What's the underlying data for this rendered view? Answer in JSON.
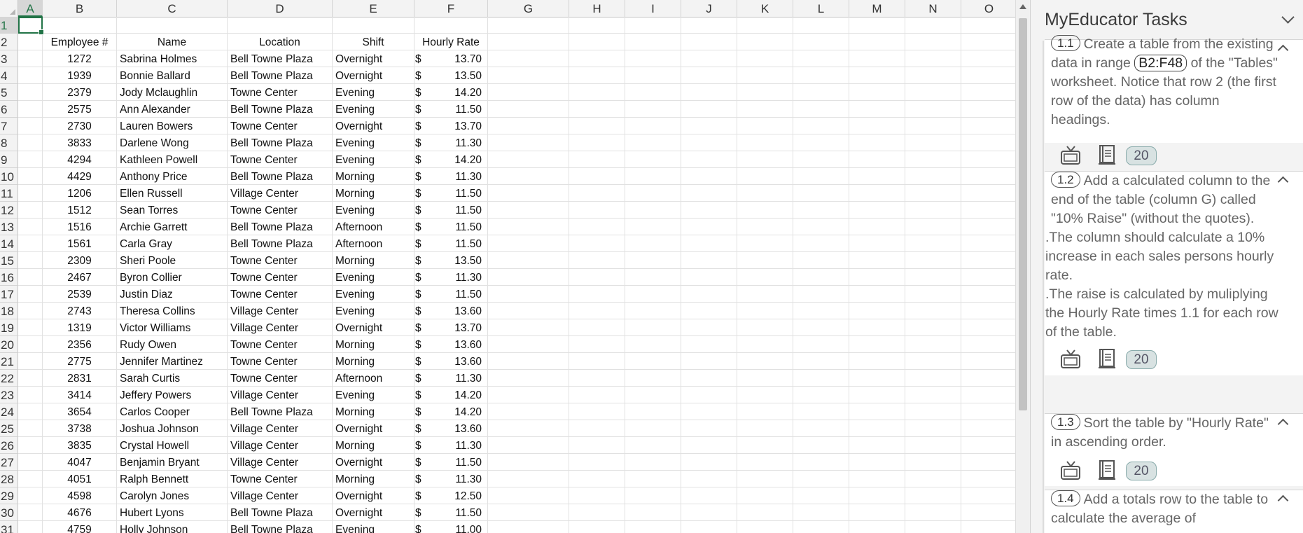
{
  "columns": [
    "A",
    "B",
    "C",
    "D",
    "E",
    "F",
    "G",
    "H",
    "I",
    "J",
    "K",
    "L",
    "M",
    "N",
    "O"
  ],
  "active_column": "A",
  "active_row": 1,
  "row_numbers": [
    "1",
    "2",
    "3",
    "4",
    "5",
    "6",
    "7",
    "8",
    "9",
    "10",
    "11",
    "12",
    "13",
    "14",
    "15",
    "16",
    "17",
    "18",
    "19",
    "20",
    "21",
    "22",
    "23",
    "24",
    "25",
    "26",
    "27",
    "28",
    "29",
    "30",
    "31"
  ],
  "table": {
    "headers": [
      "Employee #",
      "Name",
      "Location",
      "Shift",
      "Hourly Rate"
    ],
    "currency_symbol": "$",
    "rows": [
      [
        "1272",
        "Sabrina Holmes",
        "Bell Towne Plaza",
        "Overnight",
        "13.70"
      ],
      [
        "1939",
        "Bonnie Ballard",
        "Bell Towne Plaza",
        "Overnight",
        "13.50"
      ],
      [
        "2379",
        "Jody Mclaughlin",
        "Towne Center",
        "Evening",
        "14.20"
      ],
      [
        "2575",
        "Ann Alexander",
        "Bell Towne Plaza",
        "Evening",
        "11.50"
      ],
      [
        "2730",
        "Lauren Bowers",
        "Towne Center",
        "Overnight",
        "13.70"
      ],
      [
        "3833",
        "Darlene Wong",
        "Bell Towne Plaza",
        "Evening",
        "11.30"
      ],
      [
        "4294",
        "Kathleen Powell",
        "Towne Center",
        "Evening",
        "14.20"
      ],
      [
        "4429",
        "Anthony Price",
        "Bell Towne Plaza",
        "Morning",
        "11.30"
      ],
      [
        "1206",
        "Ellen Russell",
        "Village Center",
        "Morning",
        "11.50"
      ],
      [
        "1512",
        "Sean Torres",
        "Towne Center",
        "Evening",
        "11.50"
      ],
      [
        "1516",
        "Archie Garrett",
        "Bell Towne Plaza",
        "Afternoon",
        "11.50"
      ],
      [
        "1561",
        "Carla Gray",
        "Bell Towne Plaza",
        "Afternoon",
        "11.50"
      ],
      [
        "2309",
        "Sheri Poole",
        "Towne Center",
        "Morning",
        "13.50"
      ],
      [
        "2467",
        "Byron Collier",
        "Towne Center",
        "Evening",
        "11.30"
      ],
      [
        "2539",
        "Justin Diaz",
        "Towne Center",
        "Evening",
        "11.50"
      ],
      [
        "2743",
        "Theresa Collins",
        "Village Center",
        "Evening",
        "13.60"
      ],
      [
        "1319",
        "Victor Williams",
        "Village Center",
        "Overnight",
        "13.70"
      ],
      [
        "2356",
        "Rudy Owen",
        "Towne Center",
        "Morning",
        "13.60"
      ],
      [
        "2775",
        "Jennifer Martinez",
        "Towne Center",
        "Morning",
        "13.60"
      ],
      [
        "2831",
        "Sarah Curtis",
        "Towne Center",
        "Afternoon",
        "11.30"
      ],
      [
        "3414",
        "Jeffery Powers",
        "Village Center",
        "Evening",
        "14.20"
      ],
      [
        "3654",
        "Carlos Cooper",
        "Bell Towne Plaza",
        "Morning",
        "14.20"
      ],
      [
        "3738",
        "Joshua Johnson",
        "Village Center",
        "Overnight",
        "13.60"
      ],
      [
        "3835",
        "Crystal Howell",
        "Village Center",
        "Morning",
        "11.30"
      ],
      [
        "4047",
        "Benjamin Bryant",
        "Village Center",
        "Overnight",
        "11.50"
      ],
      [
        "4051",
        "Ralph Bennett",
        "Towne Center",
        "Morning",
        "11.30"
      ],
      [
        "4598",
        "Carolyn Jones",
        "Village Center",
        "Overnight",
        "12.50"
      ],
      [
        "4676",
        "Hubert Lyons",
        "Bell Towne Plaza",
        "Overnight",
        "11.50"
      ],
      [
        "4759",
        "Holly Johnson",
        "Bell Towne Plaza",
        "Evening",
        "11.00"
      ]
    ]
  },
  "task_pane": {
    "title": "MyEducator Tasks",
    "tasks": [
      {
        "number": "1.1",
        "text_before": "Create a table from the existing data in range",
        "range": "B2:F48",
        "text_after": "of the \"Tables\" worksheet. Notice that row 2 (the first row of the data) has column headings.",
        "points": "20"
      },
      {
        "number": "1.2",
        "text_main": "Add a calculated column to the end of the table (column G) called \"10% Raise\" (without the quotes).",
        "bullets": [
          "The column should calculate a 10% increase in each sales persons hourly rate.",
          "The raise is calculated by muliplying the Hourly Rate times 1.1 for each row of the table."
        ],
        "points": "20"
      },
      {
        "number": "1.3",
        "text_main": "Sort the table by \"Hourly Rate\" in ascending order.",
        "points": "20"
      },
      {
        "number": "1.4",
        "text_main": "Add a totals row to the table to calculate the average of"
      }
    ],
    "icons": [
      "video-icon",
      "book-icon"
    ]
  }
}
